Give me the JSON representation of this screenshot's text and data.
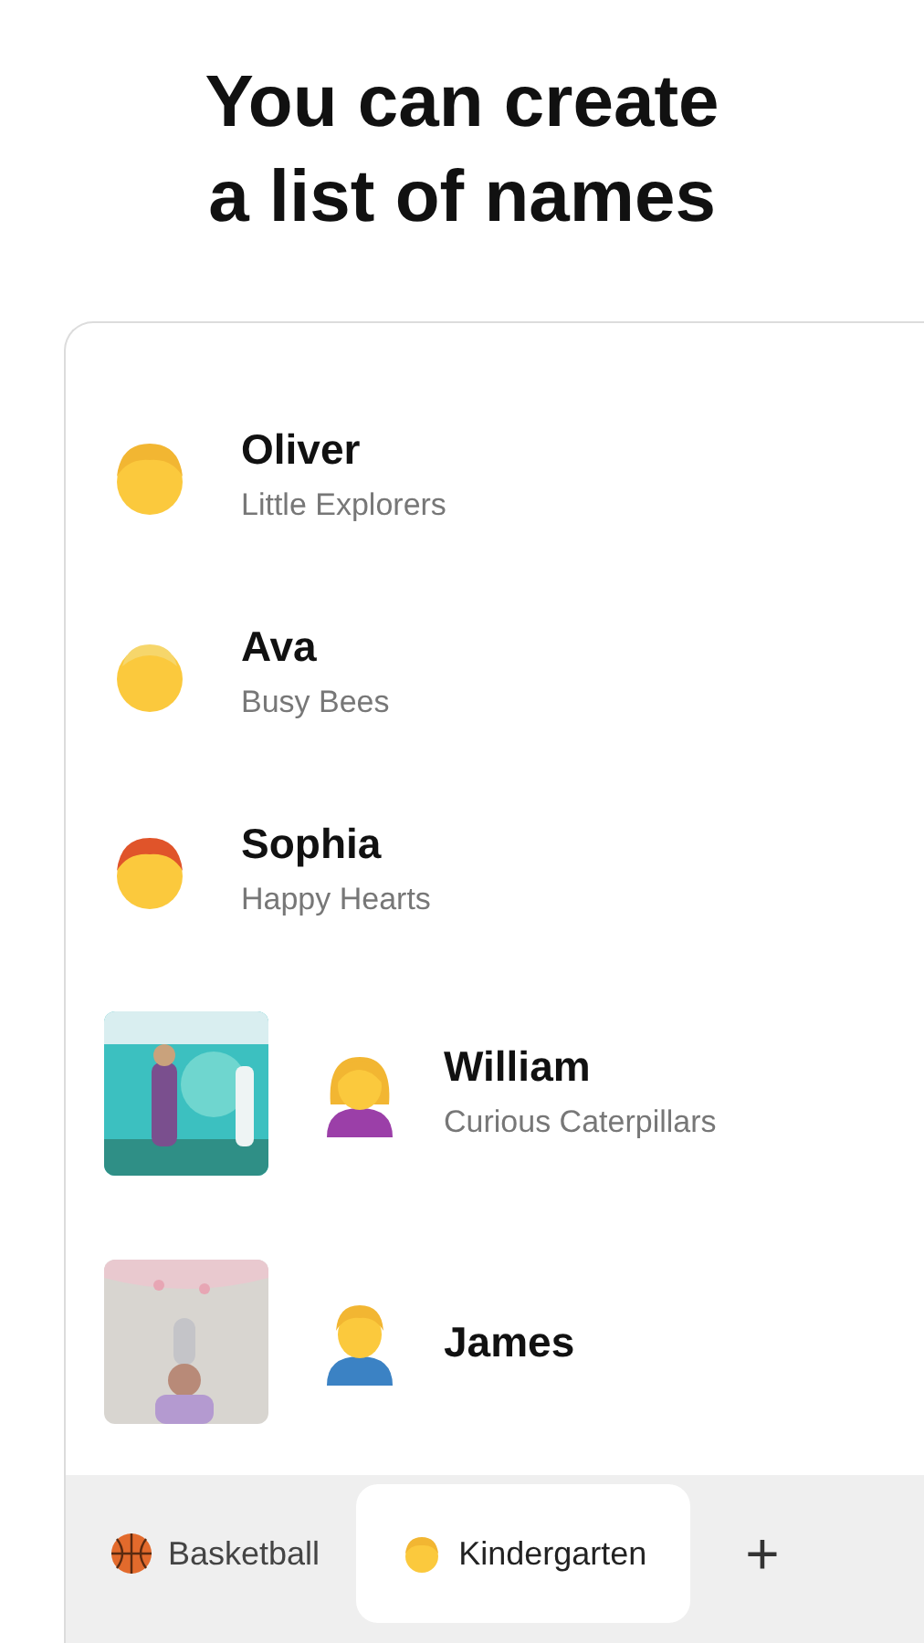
{
  "headline": "You can create\na list of names",
  "people": [
    {
      "name": "Oliver",
      "group": "Little Explorers",
      "photo": false,
      "kind": "child",
      "color": "#f2b632"
    },
    {
      "name": "Ava",
      "group": "Busy Bees",
      "photo": false,
      "kind": "adult",
      "color": "#f6d66b"
    },
    {
      "name": "Sophia",
      "group": "Happy Hearts",
      "photo": false,
      "kind": "child",
      "color": "#e0542a"
    },
    {
      "name": "William",
      "group": "Curious Caterpillars",
      "photo": true,
      "kind": "woman",
      "color": "#f2b632"
    },
    {
      "name": "James",
      "photo": true,
      "kind": "man",
      "color": "#f2b632"
    }
  ],
  "tabs": [
    {
      "label": "Basketball",
      "kind": "ball",
      "selected": false
    },
    {
      "label": "Kindergarten",
      "kind": "face",
      "selected": true
    }
  ],
  "add_button": "+"
}
